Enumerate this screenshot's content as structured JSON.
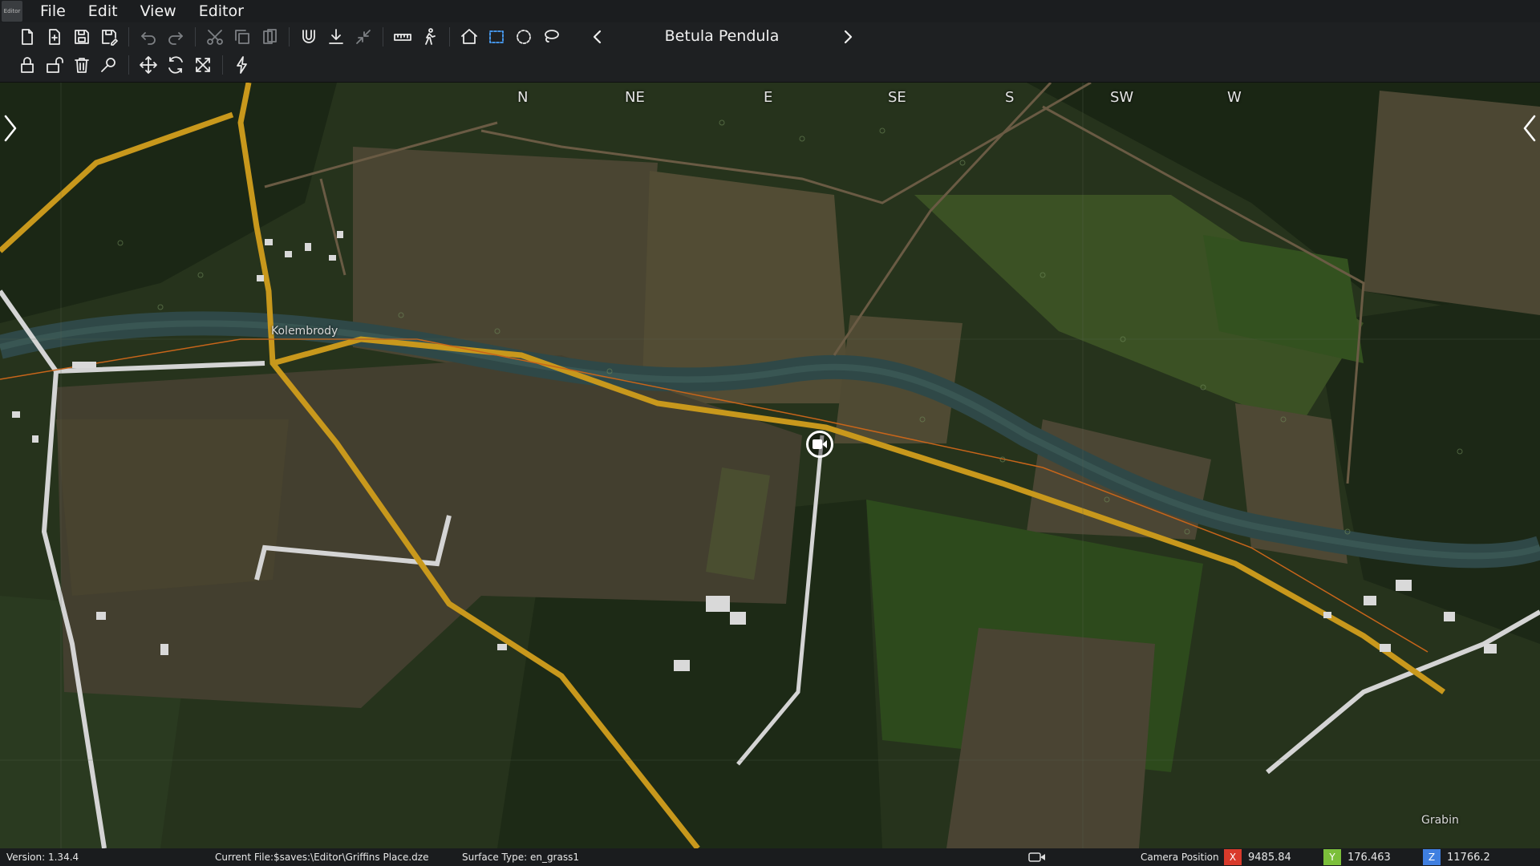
{
  "menubar": {
    "logo_text": "Editor",
    "items": [
      "File",
      "Edit",
      "View",
      "Editor"
    ]
  },
  "toolbar": {
    "row1_icons": [
      "new-file-icon",
      "import-file-icon",
      "save-icon",
      "save-as-icon",
      "undo-icon",
      "redo-icon",
      "cut-icon",
      "copy-icon",
      "paste-icon",
      "magnet-snap-icon",
      "drop-to-ground-icon",
      "collapse-icon",
      "ruler-icon",
      "walk-icon",
      "home-icon",
      "rectangle-select-icon",
      "circle-select-icon",
      "lasso-select-icon"
    ],
    "row2_icons": [
      "lock-icon",
      "unlock-icon",
      "delete-icon",
      "search-icon",
      "move-icon",
      "rotate-icon",
      "scale-icon",
      "lightning-icon"
    ],
    "object_title": "Betula Pendula"
  },
  "map": {
    "compass": [
      "N",
      "NE",
      "E",
      "SE",
      "S",
      "SW",
      "W"
    ],
    "places": [
      "Kolembrody",
      "Grabin"
    ],
    "terrain_colors": {
      "forest": "#1e2a17",
      "field": "#4a4630",
      "meadow": "#34471f",
      "river": "#2f4a48",
      "road_main": "#c8981c",
      "road_minor": "#d8d8d8"
    }
  },
  "status": {
    "version": "Version:  1.34.4",
    "current_file": "Current File:$saves:\\Editor\\Griffins Place.dze",
    "surface_type": "Surface Type: en_grass1",
    "camera_position_label": "Camera Position",
    "x_label": "X",
    "x_value": "9485.84",
    "y_label": "Y",
    "y_value": "176.463",
    "z_label": "Z",
    "z_value": "11766.2",
    "x_color": "#d93a2b",
    "y_color": "#7bbf3a",
    "z_color": "#3f7fe0"
  }
}
